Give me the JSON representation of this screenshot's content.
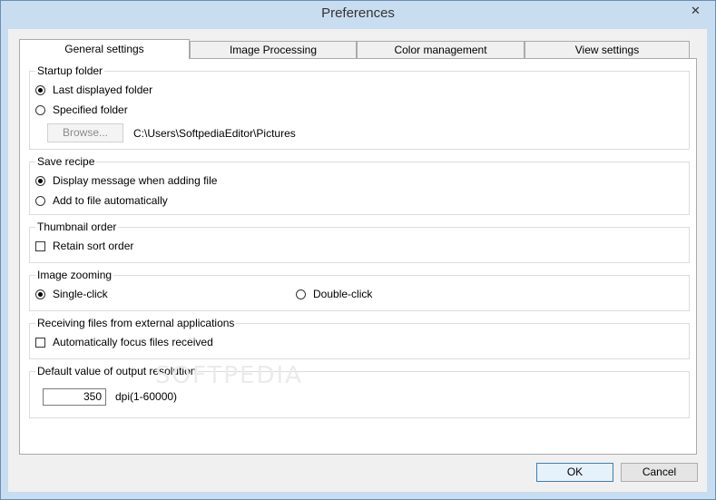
{
  "window": {
    "title": "Preferences",
    "close_glyph": "✕"
  },
  "tabs": [
    "General settings",
    "Image Processing",
    "Color management",
    "View settings"
  ],
  "startup_folder": {
    "title": "Startup folder",
    "option_last": "Last displayed folder",
    "option_specified": "Specified folder",
    "browse_label": "Browse...",
    "path": "C:\\Users\\SoftpediaEditor\\Pictures"
  },
  "save_recipe": {
    "title": "Save recipe",
    "option_display": "Display message when adding file",
    "option_add": "Add to file automatically"
  },
  "thumbnail_order": {
    "title": "Thumbnail order",
    "retain_label": "Retain sort order"
  },
  "image_zooming": {
    "title": "Image zooming",
    "option_single": "Single-click",
    "option_double": "Double-click"
  },
  "receiving_files": {
    "title": "Receiving files from external applications",
    "focus_label": "Automatically focus files received"
  },
  "output_resolution": {
    "title": "Default value of output resolution",
    "value": "350",
    "unit": "dpi(1-60000)"
  },
  "footer": {
    "ok_label": "OK",
    "cancel_label": "Cancel"
  },
  "watermark": "SOFTPEDIA"
}
